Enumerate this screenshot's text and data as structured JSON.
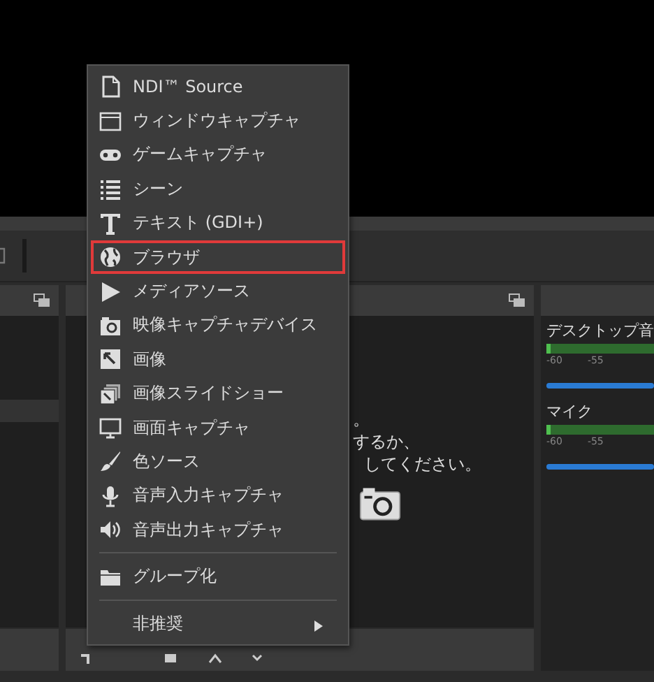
{
  "sources_hint": [
    "。",
    "するか、",
    "してください。"
  ],
  "mixer": [
    {
      "name": "デスクトップ音",
      "ticks": [
        "-60",
        "-55"
      ],
      "level": 1
    },
    {
      "name": "マイク",
      "ticks": [
        "-60",
        "-55"
      ],
      "level": 1
    }
  ],
  "context_menu": [
    {
      "kind": "item",
      "label": "NDI™ Source",
      "selected": false
    },
    {
      "kind": "item",
      "label": "ウィンドウキャプチャ",
      "selected": false
    },
    {
      "kind": "item",
      "label": "ゲームキャプチャ",
      "selected": false
    },
    {
      "kind": "item",
      "label": "シーン",
      "selected": false
    },
    {
      "kind": "item",
      "label": "テキスト (GDI+)",
      "selected": false
    },
    {
      "kind": "item",
      "label": "ブラウザ",
      "selected": true
    },
    {
      "kind": "item",
      "label": "メディアソース",
      "selected": false
    },
    {
      "kind": "item",
      "label": "映像キャプチャデバイス",
      "selected": false
    },
    {
      "kind": "item",
      "label": "画像",
      "selected": false
    },
    {
      "kind": "item",
      "label": "画像スライドショー",
      "selected": false
    },
    {
      "kind": "item",
      "label": "画面キャプチャ",
      "selected": false
    },
    {
      "kind": "item",
      "label": "色ソース",
      "selected": false
    },
    {
      "kind": "item",
      "label": "音声入力キャプチャ",
      "selected": false
    },
    {
      "kind": "item",
      "label": "音声出力キャプチャ",
      "selected": false
    },
    {
      "kind": "separator"
    },
    {
      "kind": "item",
      "label": "グループ化",
      "selected": false
    },
    {
      "kind": "separator"
    },
    {
      "kind": "submenu",
      "label": "非推奨",
      "selected": false
    }
  ]
}
